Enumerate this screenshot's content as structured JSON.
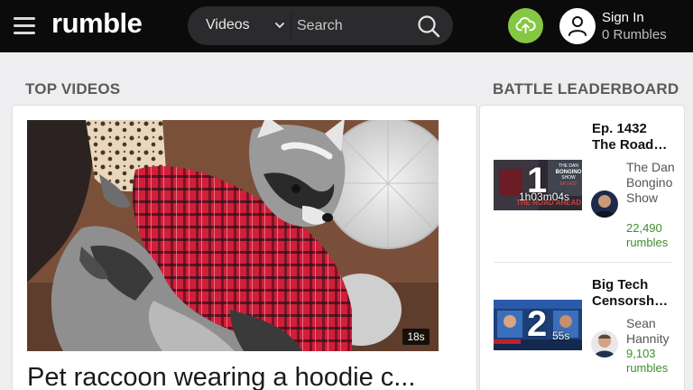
{
  "header": {
    "logo": "rumble",
    "search": {
      "type_label": "Videos",
      "placeholder": "Search"
    },
    "user": {
      "sign_in": "Sign In",
      "rumbles": "0 Rumbles"
    }
  },
  "sections": {
    "top_videos": "TOP VIDEOS",
    "battle_leaderboard": "BATTLE LEADERBOARD"
  },
  "top_video": {
    "title": "Pet raccoon wearing a hoodie c...",
    "duration": "18s"
  },
  "leaderboard": [
    {
      "rank": "1",
      "title_line1": "Ep. 1432",
      "title_line2": "The Road…",
      "duration": "1h03m04s",
      "channel": "The Dan Bongino Show",
      "rumbles": "22,490 rumbles",
      "thumb_text": [
        "THE DAN",
        "BONGINO",
        "SHOW",
        "EP.1432",
        "THE ROAD AHEAD"
      ]
    },
    {
      "rank": "2",
      "title_line1": "Big Tech",
      "title_line2": "Censorsh…",
      "duration": "55s",
      "channel": "Sean Hannity",
      "rumbles": "9,103 rumbles"
    }
  ],
  "colors": {
    "header_bg": "#0b0b0b",
    "accent_green": "#85c742",
    "rumbles_green": "#3e8e2b",
    "page_bg": "#eeeef0"
  }
}
